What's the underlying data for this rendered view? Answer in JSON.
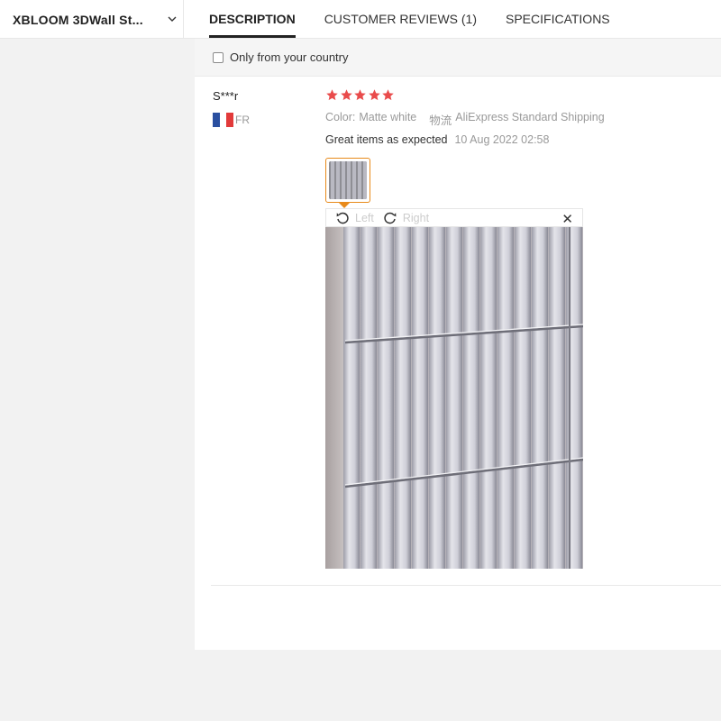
{
  "header": {
    "product_name": "XBLOOM 3DWall St...",
    "tabs": [
      {
        "label": "DESCRIPTION",
        "active": true
      },
      {
        "label": "CUSTOMER REVIEWS (1)",
        "active": false
      },
      {
        "label": "SPECIFICATIONS",
        "active": false
      }
    ]
  },
  "filter": {
    "label": "Only from your country",
    "checked": false
  },
  "review": {
    "user": "S***r",
    "country_code": "FR",
    "rating": 5,
    "color_label": "Color:",
    "color_value": "Matte white",
    "shipping_label": "物流",
    "shipping_value": "AliExpress Standard Shipping",
    "text": "Great items as expected",
    "date": "10 Aug 2022 02:58"
  },
  "viewer": {
    "left_label": "Left",
    "right_label": "Right"
  },
  "colors": {
    "star": "#e94b4b",
    "accent": "#e88a1a",
    "flag_blue": "#2a4fa0",
    "flag_white": "#ffffff",
    "flag_red": "#e23a3a"
  }
}
